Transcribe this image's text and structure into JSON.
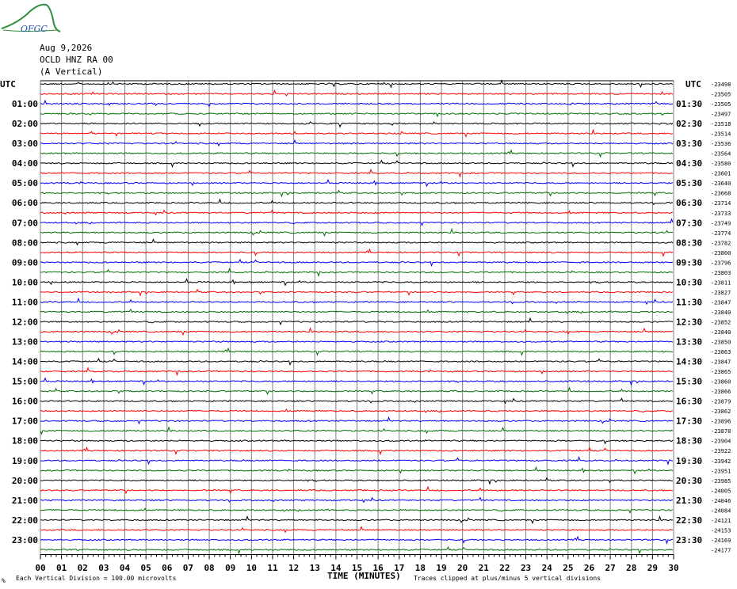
{
  "header": {
    "logo_text": "OFGC",
    "date": "Aug 9,2026",
    "station": "OCLD HNZ RA 00",
    "component": "(A Vertical)"
  },
  "footer": {
    "scale_note": "Each Vertical Division =  100.00 microvolts",
    "clip_note": "Traces clipped at plus/minus 5 vertical divisions",
    "corner_mark": "%"
  },
  "chart_data": {
    "type": "line",
    "title": "",
    "xlabel": "TIME (MINUTES)",
    "ylabel": "",
    "x_tick_labels": [
      "00",
      "01",
      "02",
      "03",
      "04",
      "05",
      "06",
      "07",
      "08",
      "09",
      "10",
      "11",
      "12",
      "13",
      "14",
      "15",
      "16",
      "17",
      "18",
      "19",
      "20",
      "21",
      "22",
      "23",
      "24",
      "25",
      "26",
      "27",
      "28",
      "29",
      "30"
    ],
    "xlim": [
      0,
      30
    ],
    "left_axis_label": "UTC",
    "right_axis_label": "UTC",
    "left_hour_labels": [
      "01:00",
      "02:00",
      "03:00",
      "04:00",
      "05:00",
      "06:00",
      "07:00",
      "08:00",
      "09:00",
      "10:00",
      "11:00",
      "12:00",
      "13:00",
      "14:00",
      "15:00",
      "16:00",
      "17:00",
      "18:00",
      "19:00",
      "20:00",
      "21:00",
      "22:00",
      "23:00"
    ],
    "right_half_labels": [
      "01:30",
      "02:30",
      "03:30",
      "04:30",
      "05:30",
      "06:30",
      "07:30",
      "08:30",
      "09:30",
      "10:30",
      "11:30",
      "12:30",
      "13:30",
      "14:30",
      "15:30",
      "16:30",
      "17:30",
      "18:30",
      "19:30",
      "20:30",
      "21:30",
      "22:30",
      "23:30"
    ],
    "trace_colors": [
      "#000000",
      "#ff0000",
      "#0000ff",
      "#007000"
    ],
    "trace_offsets": [
      -23498,
      -23505,
      -23505,
      -23497,
      -23518,
      -23514,
      -23536,
      -23564,
      -23580,
      -23601,
      -23640,
      -23668,
      -23714,
      -23733,
      -23749,
      -23774,
      -23782,
      -23800,
      -23796,
      -23803,
      -23811,
      -23827,
      -23847,
      -23840,
      -23852,
      -23840,
      -23850,
      -23863,
      -23847,
      -23865,
      -23860,
      -23866,
      -23879,
      -23862,
      -23896,
      -23878,
      -23904,
      -23922,
      -23942,
      -23951,
      -23985,
      -24005,
      -24046,
      -24084,
      -24121,
      -24153,
      -24169,
      -24177
    ],
    "grid": true
  }
}
